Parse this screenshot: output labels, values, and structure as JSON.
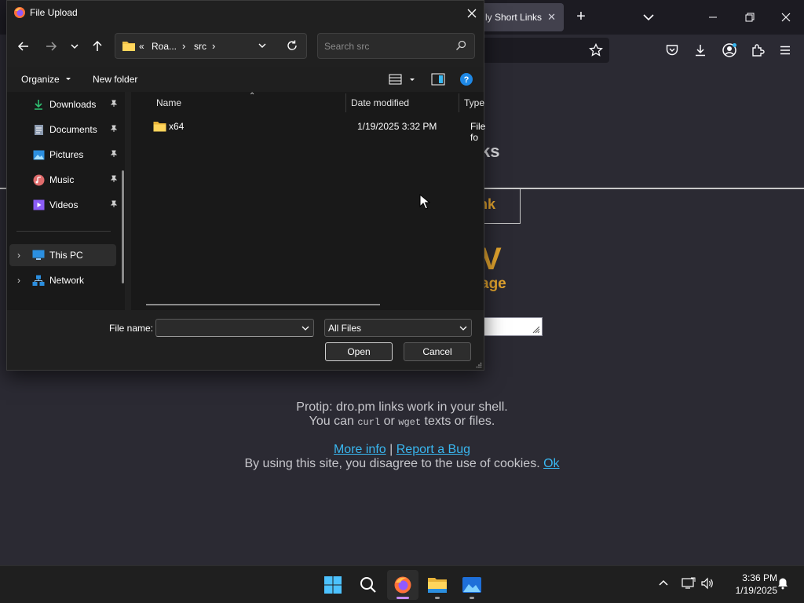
{
  "browser": {
    "tab_label": "ly Short Links",
    "tab_close": "✕",
    "new_tab": "+",
    "page": {
      "title_fragment": "ks",
      "shorten_fragment": "nk",
      "big_fragment": "V",
      "age_fragment": "age",
      "protip_line1": "Protip: dro.pm links work in your shell.",
      "protip_you_can": "You can",
      "protip_curl": "curl",
      "protip_or": "or",
      "protip_wget": "wget",
      "protip_rest": "texts or files.",
      "more_info": "More info",
      "separator": "|",
      "report_bug": "Report a Bug",
      "cookie_text": "By using this site, you disagree to the use of cookies.",
      "cookie_ok": "Ok"
    }
  },
  "dialog": {
    "title": "File Upload",
    "close": "✕",
    "address": {
      "overflow": "«",
      "segments": [
        "Roa...",
        "src"
      ],
      "chevron": "›"
    },
    "search": {
      "placeholder": "Search src"
    },
    "commands": {
      "organize": "Organize",
      "new_folder": "New folder"
    },
    "nav": {
      "quick_access": [
        {
          "label": "Downloads",
          "icon": "download-icon"
        },
        {
          "label": "Documents",
          "icon": "document-icon"
        },
        {
          "label": "Pictures",
          "icon": "picture-icon"
        },
        {
          "label": "Music",
          "icon": "music-icon"
        },
        {
          "label": "Videos",
          "icon": "video-icon"
        }
      ],
      "this_pc": "This PC",
      "network": "Network"
    },
    "columns": {
      "name": "Name",
      "date": "Date modified",
      "type": "Type"
    },
    "files": [
      {
        "name": "x64",
        "date": "1/19/2025 3:32 PM",
        "type": "File fo"
      }
    ],
    "file_name_label": "File name:",
    "file_name_value": "",
    "file_type": "All Files",
    "open": "Open",
    "cancel": "Cancel"
  },
  "taskbar": {
    "time": "3:36 PM",
    "date": "1/19/2025"
  },
  "colors": {
    "accent_orange": "#e0a32e",
    "link_blue": "#39b7f0",
    "dialog_bg": "#202020"
  }
}
